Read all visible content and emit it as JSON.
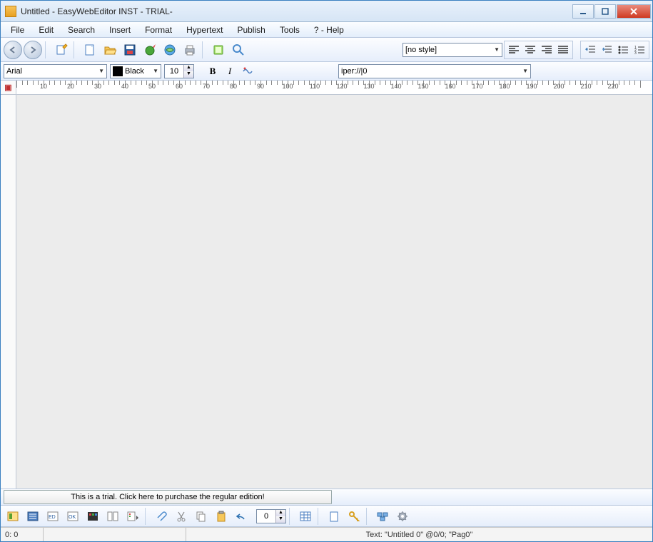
{
  "window": {
    "title": "Untitled - EasyWebEditor INST - TRIAL-"
  },
  "menu": [
    "File",
    "Edit",
    "Search",
    "Insert",
    "Format",
    "Hypertext",
    "Publish",
    "Tools",
    "? - Help"
  ],
  "toolbar1": {
    "style_value": "[no style]"
  },
  "toolbar2": {
    "font": "Arial",
    "color": "Black",
    "size": "10",
    "bold": "B",
    "italic": "I",
    "url": "iper://|0"
  },
  "ruler": {
    "marks": [
      10,
      20,
      30,
      40,
      50,
      60,
      70,
      80,
      90,
      100,
      110,
      120,
      130,
      140,
      150,
      160,
      170,
      180,
      190,
      200,
      210,
      220
    ]
  },
  "trial": {
    "label": "This is a trial. Click here to purchase the regular edition!"
  },
  "bottom": {
    "spin": "0"
  },
  "status": {
    "pos": "0: 0",
    "text": "Text: \"Untitled 0\" @0/0; \"Pag0\""
  }
}
